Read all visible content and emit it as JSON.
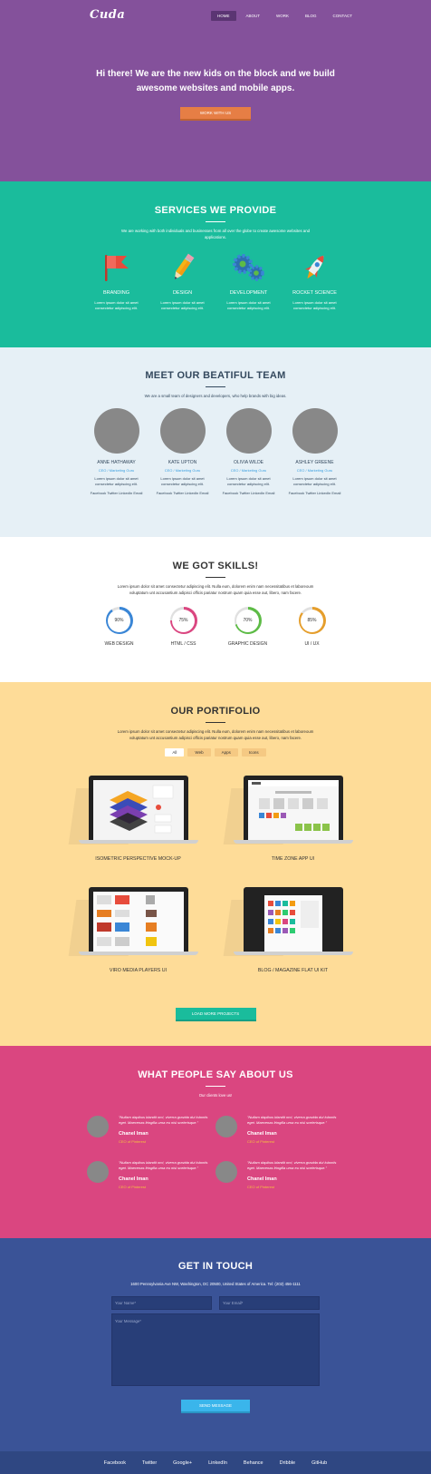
{
  "header": {
    "logo": "Cuda",
    "nav": [
      "HOME",
      "ABOUT",
      "WORK",
      "BLOG",
      "CONTACT"
    ],
    "title": "Hi there! We are the new kids on the block and we build awesome websites and mobile apps.",
    "cta": "WORK WITH US"
  },
  "services": {
    "title": "SERVICES WE PROVIDE",
    "subtitle": "We are working with both individuals and businesses from all over the globe to create awesome websites and applications.",
    "items": [
      {
        "name": "BRANDING",
        "text": "Lorem ipsum dolor sit amet consectetur adipiscing elit.",
        "icon": "flag-icon"
      },
      {
        "name": "DESIGN",
        "text": "Lorem ipsum dolor sit amet consectetur adipiscing elit.",
        "icon": "pencil-icon"
      },
      {
        "name": "DEVELOPMENT",
        "text": "Lorem ipsum dolor sit amet consectetur adipiscing elit.",
        "icon": "gears-icon"
      },
      {
        "name": "ROCKET SCIENCE",
        "text": "Lorem ipsum dolor sit amet consectetur adipiscing elit.",
        "icon": "rocket-icon"
      }
    ]
  },
  "team": {
    "title": "MEET OUR BEATIFUL TEAM",
    "subtitle": "We are a small team of designers and developers, who help brands with big ideas.",
    "members": [
      {
        "name": "ANNE HATHAWAY",
        "role": "CEO / Marketing Guru",
        "text": "Lorem ipsum dolor sit amet consectetur adipiscing elit.",
        "social": "Facebook Twitter LinkedIn Email"
      },
      {
        "name": "KATE UPTON",
        "role": "CEO / Marketing Guru",
        "text": "Lorem ipsum dolor sit amet consectetur adipiscing elit.",
        "social": "Facebook Twitter LinkedIn Email"
      },
      {
        "name": "OLIVIA WILDE",
        "role": "CEO / Marketing Guru",
        "text": "Lorem ipsum dolor sit amet consectetur adipiscing elit.",
        "social": "Facebook Twitter LinkedIn Email"
      },
      {
        "name": "ASHLEY GREENE",
        "role": "CEO / Marketing Guru",
        "text": "Lorem ipsum dolor sit amet consectetur adipiscing elit.",
        "social": "Facebook Twitter LinkedIn Email"
      }
    ]
  },
  "skills": {
    "title": "WE GOT SKILLS!",
    "subtitle": "Lorem ipsum dolor sit amet consectetur adipiscing elit. Nulla eum, dolorem enim nam necessitatibus et laboreoum voluptatum unt accusantium adipisci officis pariatur nostrum quam quia esse aut, libero, nam facere.",
    "items": [
      {
        "name": "WEB DESIGN",
        "value": 90,
        "label": "90%",
        "color": "#3a86d6"
      },
      {
        "name": "HTML / CSS",
        "value": 75,
        "label": "75%",
        "color": "#da4680"
      },
      {
        "name": "GRAPHIC DESIGN",
        "value": 70,
        "label": "70%",
        "color": "#5dbb46"
      },
      {
        "name": "UI / UX",
        "value": 85,
        "label": "85%",
        "color": "#e59e2c"
      }
    ]
  },
  "portfolio": {
    "title": "OUR PORTIFOLIO",
    "subtitle": "Lorem ipsum dolor sit amet consectetur adipiscing elit. Nulla eum, dolorem enim nam necessitatibus et laboreoum voluptatum unt accusantium adipisci officis pariatur nostrum quam quia esse aut, libero, nam facere.",
    "filters": [
      "All",
      "Web",
      "Apps",
      "Icons"
    ],
    "items": [
      {
        "title": "ISOMETRIC PERSPECTIVE MOCK-UP"
      },
      {
        "title": "TIME ZONE APP UI"
      },
      {
        "title": "VIRO MEDIA PLAYERS UI"
      },
      {
        "title": "BLOG / MAGAZINE FLAT UI KIT"
      }
    ],
    "load_more": "LOAD MORE PROJECTS"
  },
  "testimonials": {
    "title": "WHAT PEOPLE SAY ABOUT US",
    "subtitle": "Our clients love us!",
    "items": [
      {
        "quote": "\"Nullam dapibus blandit orci, viverra gravida dui lobortis eget. Maecenas fringilla urna eu nisl scelerisque.\"",
        "name": "Chanel Iman",
        "role": "CEO of Pinterest"
      },
      {
        "quote": "\"Nullam dapibus blandit orci, viverra gravida dui lobortis eget. Maecenas fringilla urna eu nisl scelerisque.\"",
        "name": "Chanel Iman",
        "role": "CEO of Pinterest"
      },
      {
        "quote": "\"Nullam dapibus blandit orci, viverra gravida dui lobortis eget. Maecenas fringilla urna eu nisl scelerisque.\"",
        "name": "Chanel Iman",
        "role": "CEO of Pinterest"
      },
      {
        "quote": "\"Nullam dapibus blandit orci, viverra gravida dui lobortis eget. Maecenas fringilla urna eu nisl scelerisque.\"",
        "name": "Chanel Iman",
        "role": "CEO of Pinterest"
      }
    ]
  },
  "contact": {
    "title": "GET IN TOUCH",
    "address": "1600 Pennsylvania Ave NW, Washington, DC 20500, United States of America. Tel: (202) 456-1111",
    "name_placeholder": "Your Name*",
    "email_placeholder": "Your Email*",
    "message_placeholder": "Your Message*",
    "send": "SEND MESSAGE"
  },
  "footer": {
    "links": [
      "Facebook",
      "Twitter",
      "Google+",
      "LinkedIn",
      "Behance",
      "Dribble",
      "GitHub"
    ]
  },
  "colors": {
    "hero": "#84519b",
    "services": "#1abc9c",
    "team": "#e6f0f6",
    "portfolio": "#fedc98",
    "testimonials": "#da4680",
    "contact": "#3a5397",
    "footer": "#2f4782"
  }
}
